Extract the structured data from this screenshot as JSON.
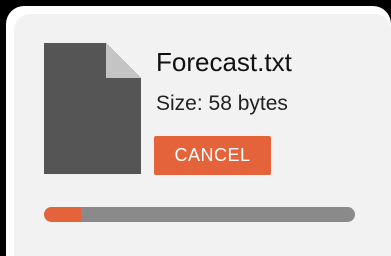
{
  "file": {
    "name": "Forecast.txt",
    "size_text": "Size: 58 bytes",
    "icon": "document-icon"
  },
  "actions": {
    "cancel_label": "CANCEL"
  },
  "progress": {
    "fraction": 0.12
  },
  "colors": {
    "accent": "#e5633a",
    "track": "#8a8a8a",
    "card_bg": "#f2f2f2",
    "icon_body": "#555555",
    "icon_fold": "#c4c4c4"
  }
}
